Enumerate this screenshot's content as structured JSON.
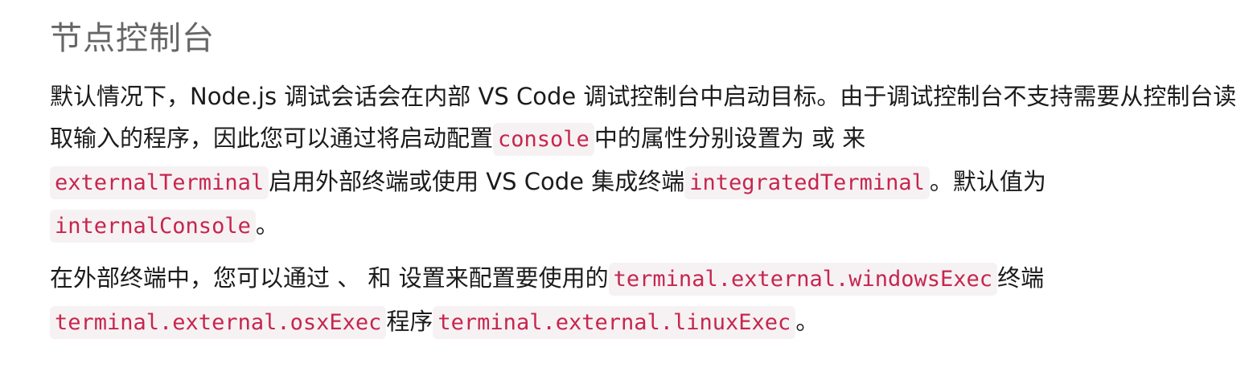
{
  "section": {
    "title": "节点控制台"
  },
  "paragraph1": {
    "text_1": "默认情况下，Node.js 调试会话会在内部 VS Code 调试控制台中启动目标。由于调试控制台不支持需要从控制台读取输入的程序，因此您可以通过将启动配置",
    "code_1": "console",
    "text_2": "中的属性分别设置为 或 来",
    "code_2": "externalTerminal",
    "text_3": "启用外部终端或使用 VS Code 集成终端",
    "code_3": "integratedTerminal",
    "text_4": "。默认值为",
    "code_4": "internalConsole",
    "text_5": "。"
  },
  "paragraph2": {
    "text_1": "在外部终端中，您可以通过 、 和 设置来配置要使用的",
    "code_1": "terminal.external.windowsExec",
    "text_2": "终端",
    "code_2": "terminal.external.osxExec",
    "text_3": "程序",
    "code_3": "terminal.external.linuxExec",
    "text_4": "。"
  },
  "colors": {
    "code_text": "#c7254e",
    "code_background": "#f6f2f3",
    "title": "#666666",
    "body_text": "#1b1b1b"
  }
}
